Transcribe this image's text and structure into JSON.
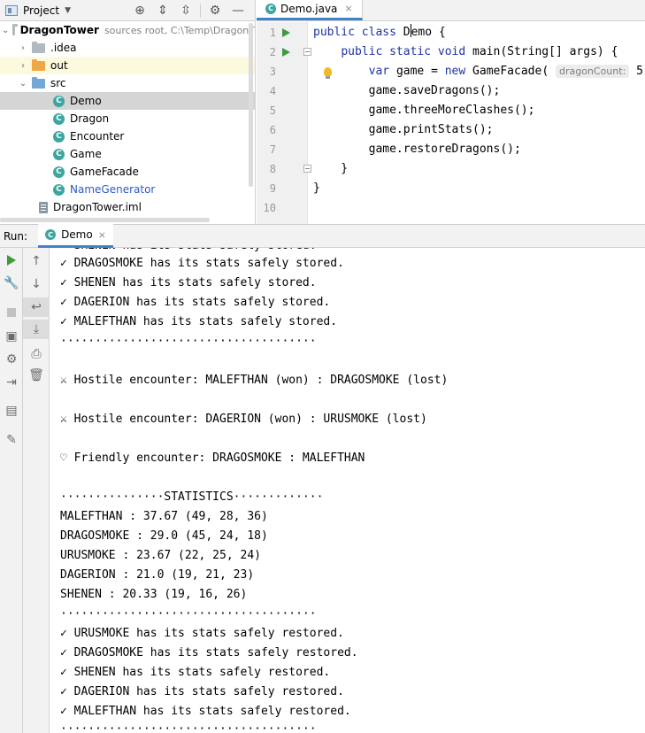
{
  "project_pane": {
    "title": "Project",
    "tree": [
      {
        "label": "DragonTower",
        "suffix": "sources root,  C:\\Temp\\DragonT"
      },
      {
        "label": ".idea"
      },
      {
        "label": "out"
      },
      {
        "label": "src"
      },
      {
        "label": "Demo"
      },
      {
        "label": "Dragon"
      },
      {
        "label": "Encounter"
      },
      {
        "label": "Game"
      },
      {
        "label": "GameFacade"
      },
      {
        "label": "NameGenerator"
      },
      {
        "label": "DragonTower.iml"
      }
    ],
    "class_icon_letter": "C"
  },
  "editor": {
    "tab_label": "Demo.java",
    "tab_close": "×",
    "line_numbers": [
      "1",
      "2",
      "3",
      "4",
      "5",
      "6",
      "7",
      "8",
      "9",
      "10"
    ],
    "code": {
      "l1_kw": "public class ",
      "l1_name_a": "D",
      "l1_name_b": "emo {",
      "l2_indent": "    ",
      "l2_kw": "public static void ",
      "l2_rest": "main(String[] args) {",
      "l3_indent": "        ",
      "l3_kw1": "var ",
      "l3_mid": "game = ",
      "l3_kw2": "new ",
      "l3_call": "GameFacade( ",
      "l3_hint": "dragonCount:",
      "l3_end": " 5)",
      "l4": "        game.saveDragons();",
      "l5": "        game.threeMoreClashes();",
      "l6": "        game.printStats();",
      "l7": "        game.restoreDragons();",
      "l8": "    }",
      "l9": "}"
    }
  },
  "run_window": {
    "label": "Run:",
    "tab_label": "Demo",
    "tab_close": "×"
  },
  "console": {
    "lines": [
      "✓ SHENEN has its stats safely stored.",
      "✓ DRAGOSMOKE has its stats safely stored.",
      "✓ SHENEN has its stats safely stored.",
      "✓ DAGERION has its stats safely stored.",
      "✓ MALEFTHAN has its stats safely stored.",
      "·····································",
      "",
      "⚔ Hostile encounter: MALEFTHAN (won) : DRAGOSMOKE (lost)",
      "",
      "⚔ Hostile encounter: DAGERION (won) : URUSMOKE (lost)",
      "",
      "♡ Friendly encounter: DRAGOSMOKE : MALEFTHAN",
      "",
      "···············STATISTICS·············",
      "MALEFTHAN : 37.67 (49, 28, 36)",
      "DRAGOSMOKE : 29.0 (45, 24, 18)",
      "URUSMOKE : 23.67 (22, 25, 24)",
      "DAGERION : 21.0 (19, 21, 23)",
      "SHENEN : 20.33 (19, 16, 26)",
      "·····································",
      "✓ URUSMOKE has its stats safely restored.",
      "✓ DRAGOSMOKE has its stats safely restored.",
      "✓ SHENEN has its stats safely restored.",
      "✓ DAGERION has its stats safely restored.",
      "✓ MALEFTHAN has its stats safely restored.",
      "·····································"
    ]
  },
  "colors": {
    "keyword": "#1d32a8",
    "run_green": "#3d9a3d",
    "class_icon": "#3ba6a0",
    "tab_accent": "#4083c9",
    "link_blue": "#2f59c3"
  }
}
